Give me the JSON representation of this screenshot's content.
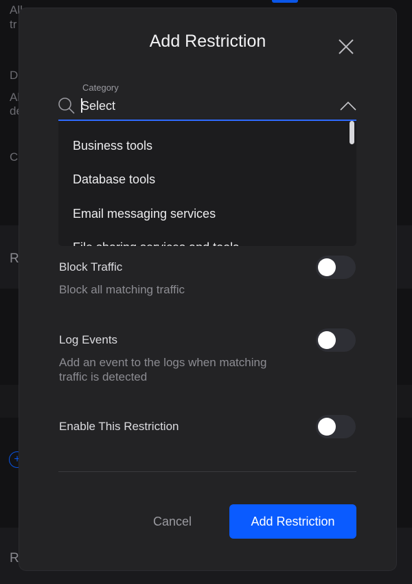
{
  "background": {
    "fragments": [
      "All",
      "tr",
      "D",
      "Al",
      "de",
      "C",
      "R",
      "R"
    ]
  },
  "modal": {
    "title": "Add Restriction",
    "close_icon": "close-icon",
    "category": {
      "label": "Category",
      "placeholder": "Select",
      "search_icon": "search-icon",
      "chevron_icon": "chevron-up-icon",
      "options": [
        "Business tools",
        "Database tools",
        "Email messaging services",
        "File sharing services and tools"
      ]
    },
    "block_traffic": {
      "title": "Block Traffic",
      "description": "Block all matching traffic",
      "enabled": false
    },
    "log_events": {
      "title": "Log Events",
      "description": "Add an event to the logs when matching traffic is detected",
      "enabled": false
    },
    "enable_restriction": {
      "title": "Enable This Restriction",
      "enabled": false
    },
    "buttons": {
      "cancel": "Cancel",
      "submit": "Add Restriction"
    }
  },
  "colors": {
    "accent": "#0a5bff",
    "modal_bg": "#232325",
    "page_bg": "#121214"
  }
}
